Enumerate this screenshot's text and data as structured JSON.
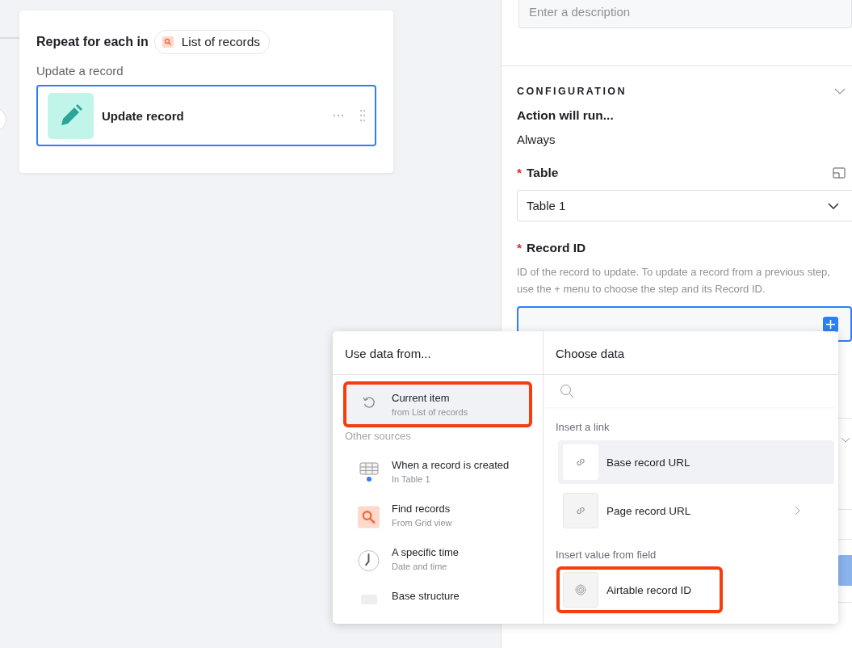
{
  "canvas": {
    "loop_label": "Repeat for each in",
    "loop_source": "List of records",
    "group_label": "Update a record",
    "action": {
      "title": "Update record",
      "selected": true
    }
  },
  "panel": {
    "description": {
      "placeholder": "Enter a description"
    },
    "section_title": "CONFIGURATION",
    "expanded": true,
    "run_label": "Action will run...",
    "run_value": "Always",
    "fields": [
      {
        "kind": "select",
        "label": "Table",
        "required": true,
        "required_mark": "*",
        "value": "Table 1"
      },
      {
        "kind": "token",
        "label": "Record ID",
        "required": true,
        "required_mark": "*",
        "help": "ID of the record to update. To update a record from a previous step, use the + menu to choose the step and its Record ID.",
        "focused": true
      }
    ]
  },
  "popup": {
    "sources_title": "Use data from...",
    "current": {
      "kind": "loop",
      "title": "Current item",
      "subtitle": "from List of records",
      "selected": true,
      "annotated": true
    },
    "other_heading": "Other sources",
    "sources": [
      {
        "kind": "trigger",
        "title": "When a record is created",
        "subtitle": "In Table 1",
        "selected": false
      },
      {
        "kind": "find",
        "title": "Find records",
        "subtitle": "From Grid view",
        "selected": false
      },
      {
        "kind": "time",
        "title": "A specific time",
        "subtitle": "Date and time",
        "selected": false
      },
      {
        "kind": "base",
        "title": "Base structure",
        "selected": false
      }
    ],
    "data_title": "Choose data",
    "groups": [
      {
        "heading": "Insert a link",
        "items": [
          {
            "kind": "link",
            "label": "Base record URL",
            "selected": true,
            "submenu": false,
            "annotated": false
          },
          {
            "kind": "link",
            "label": "Page record URL",
            "selected": false,
            "submenu": true,
            "annotated": false
          }
        ]
      },
      {
        "heading": "Insert value from field",
        "items": [
          {
            "kind": "id",
            "label": "Airtable record ID",
            "selected": false,
            "submenu": false,
            "annotated": true
          }
        ]
      }
    ]
  }
}
